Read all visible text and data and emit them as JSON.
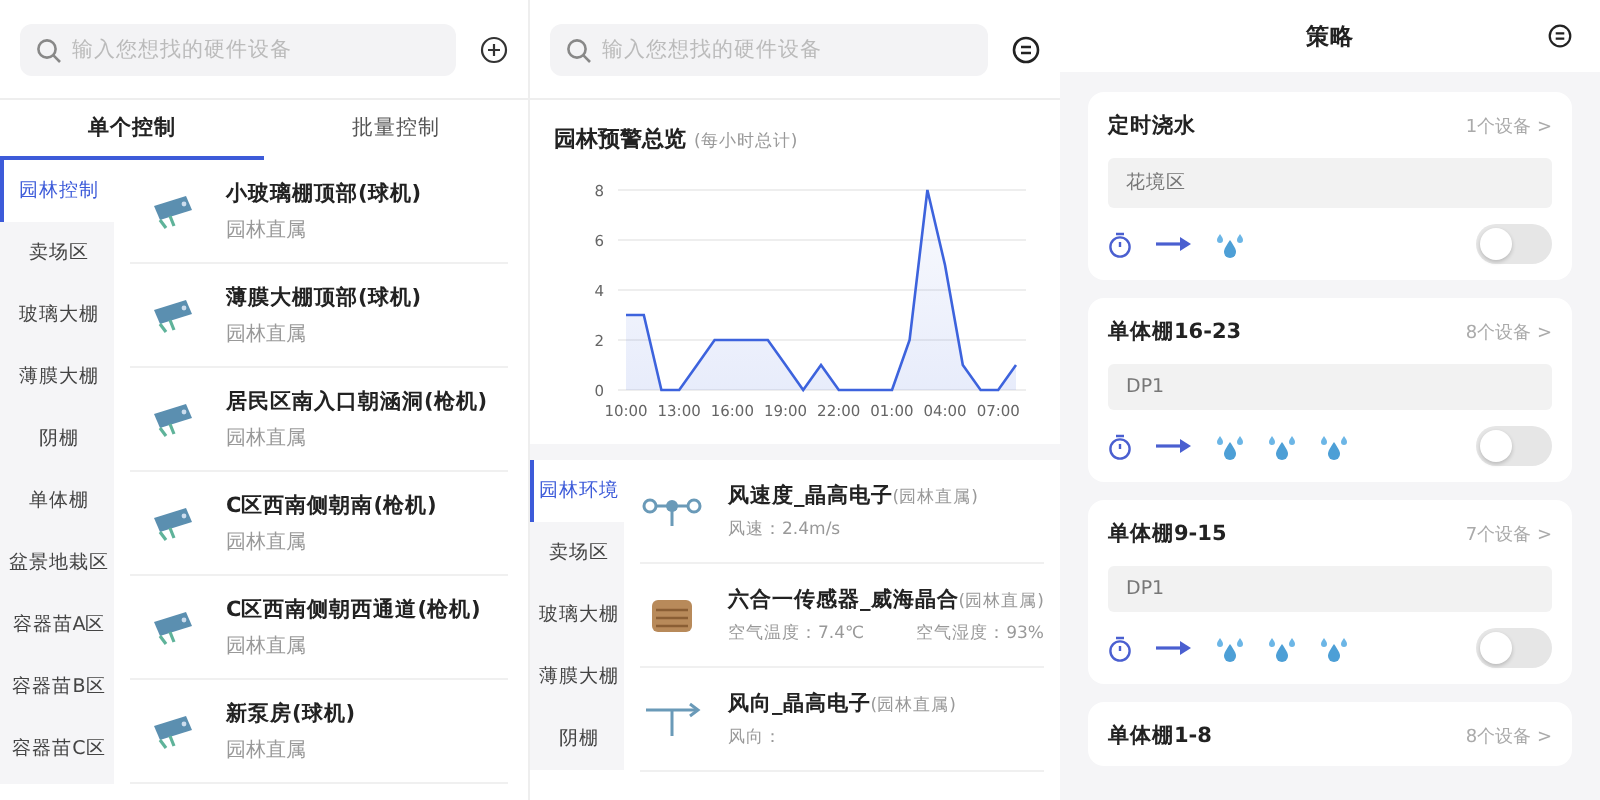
{
  "left_panel": {
    "search": {
      "placeholder": "输入您想找的硬件设备"
    },
    "tabs": [
      {
        "label": "单个控制",
        "selected": true
      },
      {
        "label": "批量控制",
        "selected": false
      }
    ],
    "sidebar": {
      "items": [
        {
          "label": "园林控制",
          "selected": true
        },
        {
          "label": "卖场区",
          "selected": false
        },
        {
          "label": "玻璃大棚",
          "selected": false
        },
        {
          "label": "薄膜大棚",
          "selected": false
        },
        {
          "label": "阴棚",
          "selected": false
        },
        {
          "label": "单体棚",
          "selected": false
        },
        {
          "label": "盆景地栽区",
          "selected": false
        },
        {
          "label": "容器苗A区",
          "selected": false
        },
        {
          "label": "容器苗B区",
          "selected": false
        },
        {
          "label": "容器苗C区",
          "selected": false
        }
      ]
    },
    "devices": [
      {
        "name": "小玻璃棚顶部(球机)",
        "owner": "园林直属"
      },
      {
        "name": "薄膜大棚顶部(球机)",
        "owner": "园林直属"
      },
      {
        "name": "居民区南入口朝涵洞(枪机)",
        "owner": "园林直属"
      },
      {
        "name": "C区西南侧朝南(枪机)",
        "owner": "园林直属"
      },
      {
        "name": "C区西南侧朝西通道(枪机)",
        "owner": "园林直属"
      },
      {
        "name": "新泵房(球机)",
        "owner": "园林直属"
      }
    ]
  },
  "middle_panel": {
    "search": {
      "placeholder": "输入您想找的硬件设备"
    },
    "chart_card": {
      "title": "园林预警总览",
      "subtitle": "(每小时总计)",
      "chart_data": {
        "type": "area",
        "categories": [
          "10:00",
          null,
          null,
          "13:00",
          null,
          null,
          "16:00",
          null,
          null,
          "19:00",
          null,
          null,
          "22:00",
          null,
          null,
          "01:00",
          null,
          null,
          "04:00",
          null,
          null,
          "07:00",
          null
        ],
        "series": [
          {
            "color": "#3d63dd",
            "values": [
              3,
              3,
              0,
              0,
              1,
              2,
              2,
              2,
              2,
              1,
              0,
              1,
              0,
              0,
              0,
              0,
              2,
              8,
              5,
              1,
              0,
              0,
              1
            ]
          }
        ],
        "ylim": [
          0,
          8
        ],
        "yticks": [
          0,
          2,
          4,
          6,
          8
        ],
        "grid": true
      }
    },
    "sidebar": {
      "items": [
        {
          "label": "园林环境",
          "selected": true
        },
        {
          "label": "卖场区",
          "selected": false
        },
        {
          "label": "玻璃大棚",
          "selected": false
        },
        {
          "label": "薄膜大棚",
          "selected": false
        },
        {
          "label": "阴棚",
          "selected": false
        }
      ]
    },
    "sensors": [
      {
        "kind": "wind-speed",
        "name": "风速度_晶高电子",
        "owner": "(园林直属)",
        "readings": [
          "风速：2.4m/s"
        ]
      },
      {
        "kind": "multi-sensor",
        "name": "六合一传感器_威海晶合",
        "owner": "(园林直属)",
        "readings": [
          "空气温度：7.4℃",
          "空气湿度：93%"
        ]
      },
      {
        "kind": "wind-direction",
        "name": "风向_晶高电子",
        "owner": "(园林直属)",
        "readings": [
          "风向："
        ]
      }
    ]
  },
  "right_panel": {
    "title": "策略",
    "strategies": [
      {
        "name": "定时浇水",
        "device_count": "1个设备 >",
        "area": "花境区",
        "outputs": [
          {
            "kind": "sprinkler"
          }
        ],
        "on": false
      },
      {
        "name": "单体棚16-23",
        "device_count": "8个设备 >",
        "area": "DP1",
        "outputs": [
          {
            "kind": "sprinkler"
          },
          {
            "kind": "sprinkler"
          },
          {
            "kind": "sprinkler"
          }
        ],
        "on": false
      },
      {
        "name": "单体棚9-15",
        "device_count": "7个设备 >",
        "area": "DP1",
        "outputs": [
          {
            "kind": "sprinkler"
          },
          {
            "kind": "sprinkler"
          },
          {
            "kind": "sprinkler"
          }
        ],
        "on": false
      },
      {
        "name": "单体棚1-8",
        "device_count": "8个设备 >"
      }
    ]
  }
}
